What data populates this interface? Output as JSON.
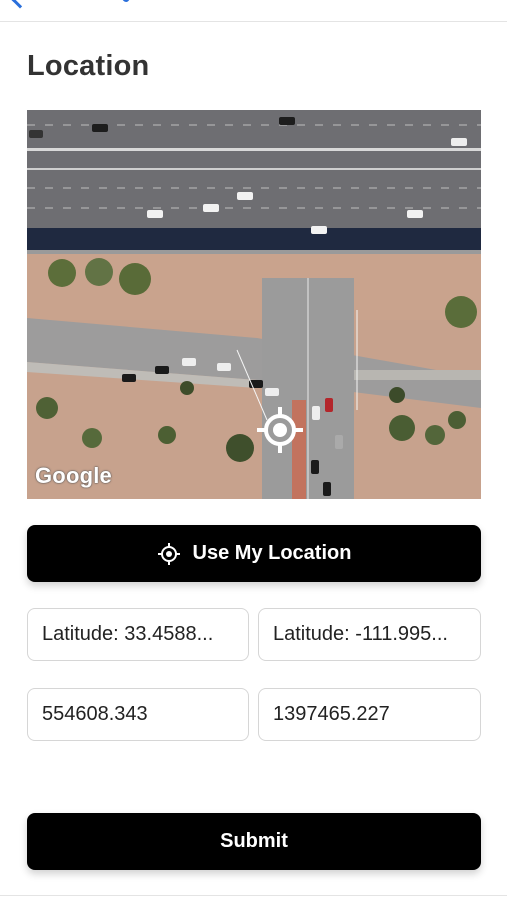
{
  "header": {
    "title": "Location"
  },
  "map": {
    "attribution": "Google"
  },
  "buttons": {
    "use_location_label": "Use My Location",
    "submit_label": "Submit"
  },
  "fields": {
    "latitude": "Latitude: 33.4588...",
    "longitude": "Latitude: -111.995...",
    "easting": "554608.343",
    "northing": "1397465.227"
  },
  "colors": {
    "button_bg": "#000000",
    "button_text": "#ffffff",
    "field_border": "#d6d6d6",
    "title_text": "#333333",
    "back_accent": "#2a6fdb"
  }
}
